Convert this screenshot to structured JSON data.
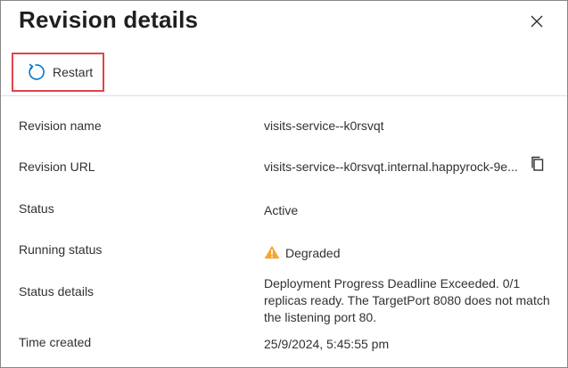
{
  "panel": {
    "title": "Revision details",
    "close_label": "Close"
  },
  "toolbar": {
    "restart_label": "Restart"
  },
  "fields": {
    "revision_name": {
      "label": "Revision name",
      "value": "visits-service--k0rsvqt"
    },
    "revision_url": {
      "label": "Revision URL",
      "value": "visits-service--k0rsvqt.internal.happyrock-9e..."
    },
    "status": {
      "label": "Status",
      "value": "Active"
    },
    "running_status": {
      "label": "Running status",
      "value": "Degraded"
    },
    "status_details": {
      "label": "Status details",
      "value": "Deployment Progress Deadline Exceeded. 0/1 replicas ready. The TargetPort 8080 does not match the listening port 80."
    },
    "time_created": {
      "label": "Time created",
      "value": "25/9/2024, 5:45:55 pm"
    }
  },
  "icons": {
    "close": "close-icon",
    "restart": "restart-icon",
    "copy": "copy-icon",
    "warning": "warning-icon"
  },
  "colors": {
    "link": "#0f6cbd",
    "highlight_border": "#e0454a",
    "warning": "#f7a531",
    "restart_icon": "#0078d4"
  }
}
